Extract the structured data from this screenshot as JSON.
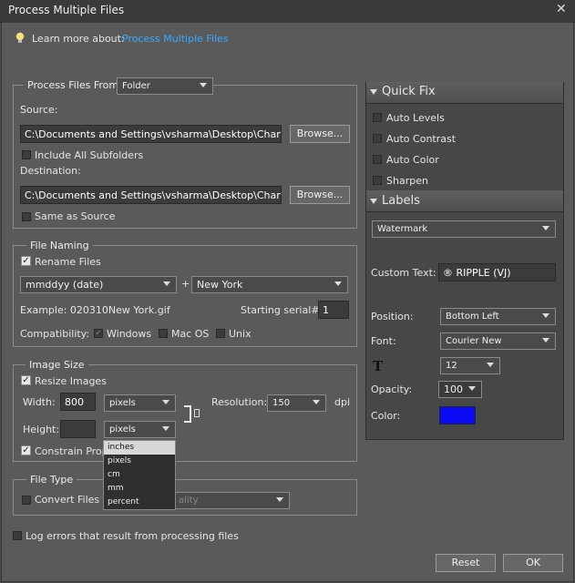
{
  "window": {
    "title": "Process Multiple Files",
    "close_glyph": "✕"
  },
  "learn": {
    "label": "Learn more about:",
    "link": "Process Multiple Files"
  },
  "process_from": {
    "legend": "Process Files From:",
    "mode": "Folder",
    "source_label": "Source:",
    "source_path": "C:\\Documents and Settings\\vsharma\\Desktop\\Chamba\\",
    "browse_label": "Browse...",
    "include_subfolders": "Include All Subfolders",
    "destination_label": "Destination:",
    "destination_path": "C:\\Documents and Settings\\vsharma\\Desktop\\Chamba\\",
    "same_as_source": "Same as Source"
  },
  "file_naming": {
    "legend": "File Naming",
    "rename_files": "Rename Files",
    "pattern": "mmddyy (date)",
    "plus": "+",
    "suffix": "New York",
    "example": "Example: 020310New York.gif",
    "starting_serial_label": "Starting serial#:",
    "starting_serial": "1",
    "compatibility_label": "Compatibility:",
    "windows": "Windows",
    "macos": "Mac OS",
    "unix": "Unix"
  },
  "image_size": {
    "legend": "Image Size",
    "resize_images": "Resize Images",
    "width_label": "Width:",
    "width_value": "800",
    "width_unit": "pixels",
    "resolution_label": "Resolution:",
    "resolution_value": "150",
    "dpi": "dpi",
    "height_label": "Height:",
    "height_unit": "pixels",
    "constrain": "Constrain Prop",
    "unit_options": [
      "inches",
      "pixels",
      "cm",
      "mm",
      "percent"
    ],
    "highlighted_option": "inches"
  },
  "file_type": {
    "legend": "File Type",
    "convert": "Convert Files to",
    "quality": "ality"
  },
  "log_errors": "Log errors that result from processing files",
  "quick_fix": {
    "title": "Quick Fix",
    "items": [
      "Auto Levels",
      "Auto Contrast",
      "Auto Color",
      "Sharpen"
    ]
  },
  "labels": {
    "title": "Labels",
    "type": "Watermark",
    "custom_text_label": "Custom Text:",
    "custom_text": "® RIPPLE (VJ)",
    "position_label": "Position:",
    "position": "Bottom Left",
    "font_label": "Font:",
    "font": "Courier New",
    "size": "12",
    "opacity_label": "Opacity:",
    "opacity": "100",
    "color_label": "Color:",
    "color": "#0a0af5"
  },
  "buttons": {
    "reset": "Reset",
    "ok": "OK"
  },
  "colors": {
    "link": "#3aa8ff",
    "bulb": "#f5e27a"
  }
}
